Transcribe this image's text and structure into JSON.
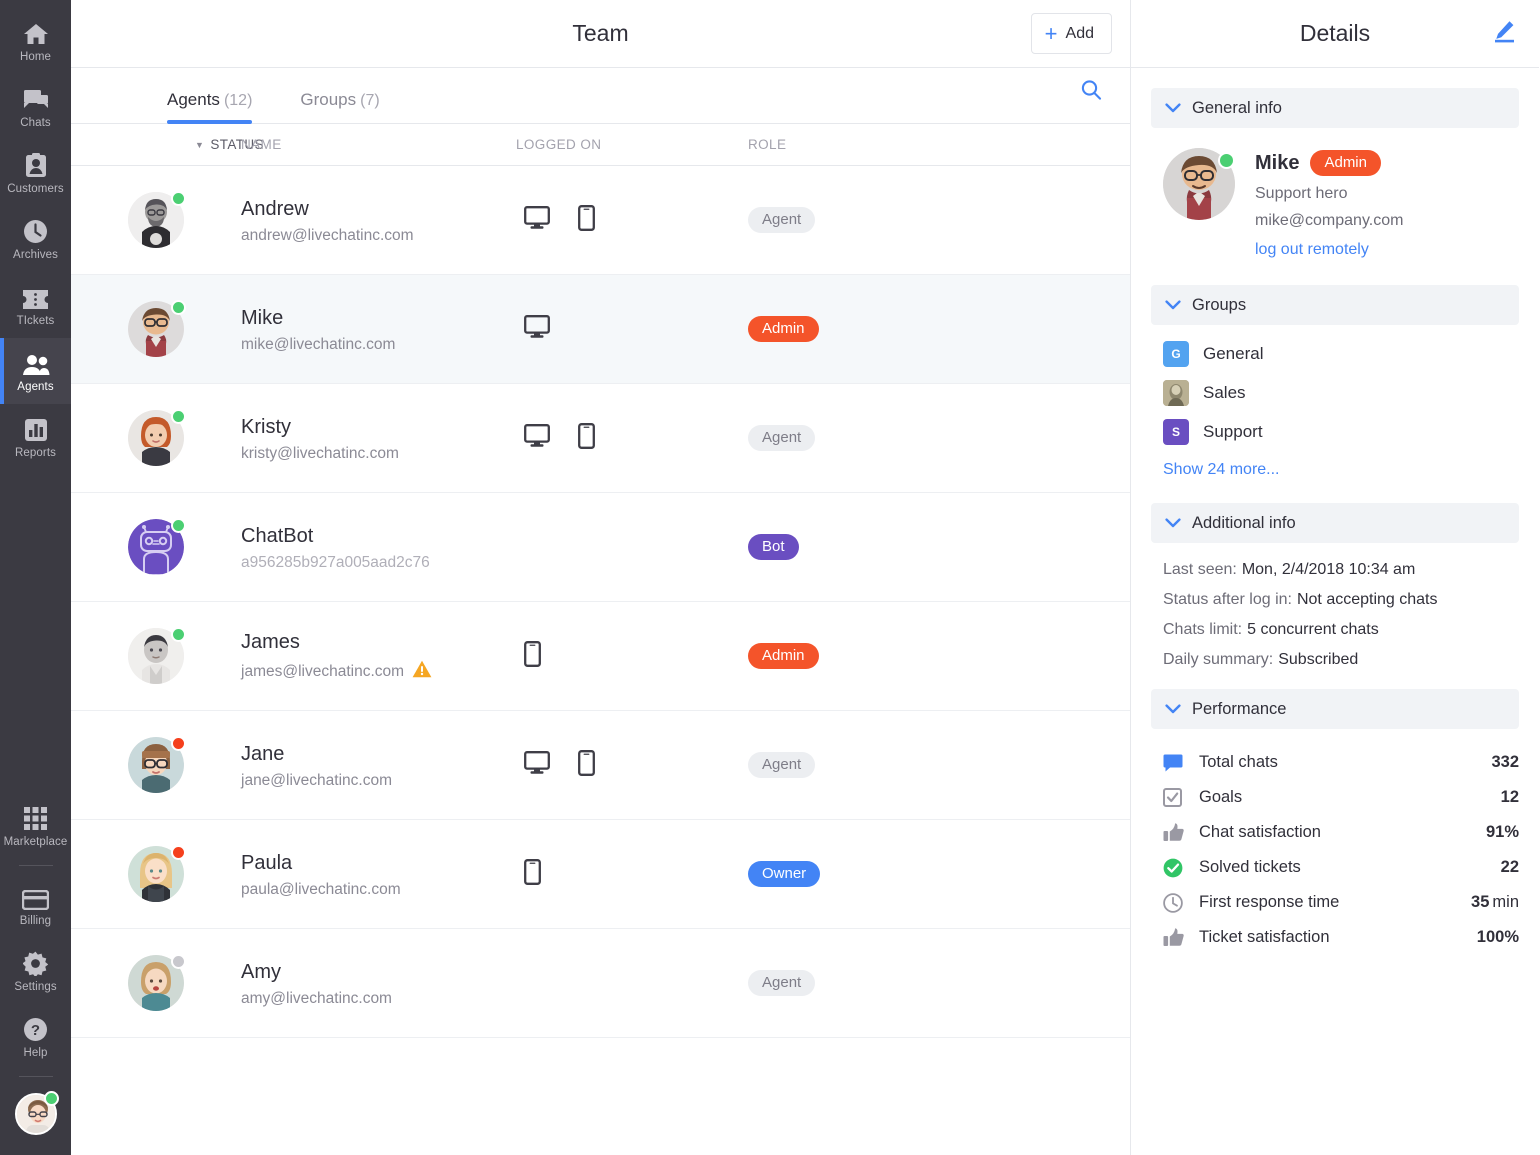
{
  "nav": {
    "top_items": [
      {
        "label": "Home",
        "icon": "home-icon",
        "active": false
      },
      {
        "label": "Chats",
        "icon": "chats-icon",
        "active": false
      },
      {
        "label": "Customers",
        "icon": "customers-icon",
        "active": false
      },
      {
        "label": "Archives",
        "icon": "archives-icon",
        "active": false
      },
      {
        "label": "TIckets",
        "icon": "tickets-icon",
        "active": false
      },
      {
        "label": "Agents",
        "icon": "agents-icon",
        "active": true
      },
      {
        "label": "Reports",
        "icon": "reports-icon",
        "active": false
      }
    ],
    "bottom_items": [
      {
        "label": "Marketplace",
        "icon": "marketplace-icon"
      },
      {
        "label": "Billing",
        "icon": "billing-icon"
      },
      {
        "label": "Settings",
        "icon": "gear-icon"
      },
      {
        "label": "Help",
        "icon": "help-icon"
      }
    ],
    "avatar_status": "online",
    "accent": "#4384f5"
  },
  "center": {
    "title": "Team",
    "add_label": "Add",
    "tabs": [
      {
        "label": "Agents",
        "count": "(12)",
        "active": true
      },
      {
        "label": "Groups",
        "count": "(7)",
        "active": false
      }
    ],
    "columns": {
      "status": "STATUS",
      "name": "NAME",
      "logged_on": "LOGGED ON",
      "role": "ROLE"
    },
    "rows": [
      {
        "name": "Andrew",
        "email": "andrew@livechatinc.com",
        "status": "online",
        "devices": [
          "desktop",
          "mobile"
        ],
        "role": "Agent",
        "role_type": "agent",
        "selected": false,
        "warning": false,
        "avatar": "photo-andrew"
      },
      {
        "name": "Mike",
        "email": "mike@livechatinc.com",
        "status": "online",
        "devices": [
          "desktop"
        ],
        "role": "Admin",
        "role_type": "admin",
        "selected": true,
        "warning": false,
        "avatar": "photo-mike"
      },
      {
        "name": "Kristy",
        "email": "kristy@livechatinc.com",
        "status": "online",
        "devices": [
          "desktop",
          "mobile"
        ],
        "role": "Agent",
        "role_type": "agent",
        "selected": false,
        "warning": false,
        "avatar": "photo-kristy"
      },
      {
        "name": "ChatBot",
        "email": "a956285b927a005aad2c76",
        "status": "online",
        "devices": [],
        "role": "Bot",
        "role_type": "bot",
        "selected": false,
        "warning": false,
        "avatar": "bot-avatar",
        "email_faded": true
      },
      {
        "name": "James",
        "email": "james@livechatinc.com",
        "status": "online",
        "devices": [
          "mobile"
        ],
        "role": "Admin",
        "role_type": "admin",
        "selected": false,
        "warning": true,
        "avatar": "photo-james"
      },
      {
        "name": "Jane",
        "email": "jane@livechatinc.com",
        "status": "busy",
        "devices": [
          "desktop",
          "mobile"
        ],
        "role": "Agent",
        "role_type": "agent",
        "selected": false,
        "warning": false,
        "avatar": "photo-jane"
      },
      {
        "name": "Paula",
        "email": "paula@livechatinc.com",
        "status": "busy",
        "devices": [
          "mobile"
        ],
        "role": "Owner",
        "role_type": "owner",
        "selected": false,
        "warning": false,
        "avatar": "photo-paula"
      },
      {
        "name": "Amy",
        "email": "amy@livechatinc.com",
        "status": "offline",
        "devices": [],
        "role": "Agent",
        "role_type": "agent",
        "selected": false,
        "warning": false,
        "avatar": "photo-amy"
      }
    ]
  },
  "details": {
    "title": "Details",
    "sections": {
      "general": "General info",
      "groups": "Groups",
      "additional": "Additional info",
      "performance": "Performance"
    },
    "profile": {
      "name": "Mike",
      "badge": "Admin",
      "role_desc": "Support hero",
      "email": "mike@company.com",
      "logout_link": "log out remotely",
      "status": "online"
    },
    "groups": [
      {
        "label": "General",
        "initial": "G",
        "color": "#53a3f0"
      },
      {
        "label": "Sales",
        "initial": "",
        "color": "#b9b093"
      },
      {
        "label": "Support",
        "initial": "S",
        "color": "#6a4ec1"
      }
    ],
    "show_more": "Show 24 more...",
    "additional": [
      {
        "key": "Last seen:",
        "value": "Mon, 2/4/2018 10:34 am"
      },
      {
        "key": "Status after log in:",
        "value": "Not accepting chats"
      },
      {
        "key": "Chats limit:",
        "value": "5 concurrent chats"
      },
      {
        "key": "Daily summary:",
        "value": "Subscribed"
      }
    ],
    "performance": [
      {
        "icon": "chat-bubble-icon",
        "label": "Total chats",
        "value": "332",
        "unit": ""
      },
      {
        "icon": "checkbox-icon",
        "label": "Goals",
        "value": "12",
        "unit": ""
      },
      {
        "icon": "thumbs-up-icon",
        "label": "Chat  satisfaction",
        "value": "91%",
        "unit": ""
      },
      {
        "icon": "check-circle-icon",
        "label": "Solved tickets",
        "value": "22",
        "unit": ""
      },
      {
        "icon": "clock-icon",
        "label": "First response time",
        "value": "35",
        "unit": "min"
      },
      {
        "icon": "thumbs-up-icon",
        "label": "Ticket  satisfaction",
        "value": "100%",
        "unit": ""
      }
    ]
  },
  "colors": {
    "accent": "#4384f5",
    "admin": "#f4542a",
    "bot": "#6a4ec1",
    "owner": "#4384f5",
    "online": "#4bcf72",
    "busy": "#f5401d",
    "offline": "#c8c8cd",
    "nav_bg": "#3b3a42"
  }
}
